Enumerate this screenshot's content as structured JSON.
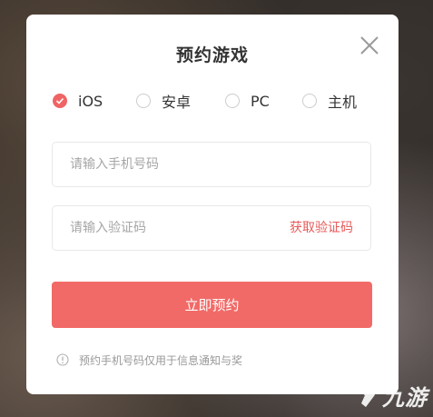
{
  "modal": {
    "title": "预约游戏",
    "close_icon": "close-icon"
  },
  "platforms": [
    {
      "label": "iOS",
      "checked": true
    },
    {
      "label": "安卓",
      "checked": false
    },
    {
      "label": "PC",
      "checked": false
    },
    {
      "label": "主机",
      "checked": false
    }
  ],
  "phone": {
    "placeholder": "请输入手机号码"
  },
  "code": {
    "placeholder": "请输入验证码",
    "get_code_label": "获取验证码"
  },
  "submit_label": "立即预约",
  "notice": {
    "icon": "info-icon",
    "text": "预约手机号码仅用于信息通知与奖"
  },
  "watermark": {
    "text": "九游"
  },
  "colors": {
    "accent": "#f16a67",
    "link": "#e85a5a",
    "text": "#333333",
    "muted": "#999999"
  }
}
